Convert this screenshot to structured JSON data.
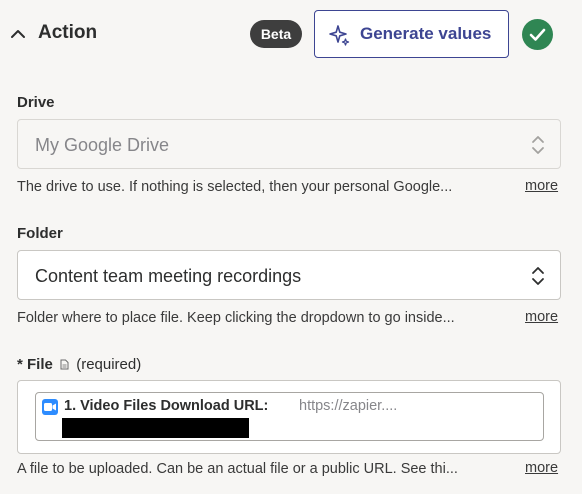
{
  "header": {
    "title": "Action",
    "badge": "Beta",
    "generate_button": "Generate values"
  },
  "drive": {
    "label": "Drive",
    "value": "My Google Drive",
    "help": "The drive to use. If nothing is selected, then your personal Google...",
    "more": "more"
  },
  "folder": {
    "label": "Folder",
    "value": "Content team meeting recordings",
    "help": "Folder where to place file. Keep clicking the dropdown to go inside...",
    "more": "more"
  },
  "file": {
    "asterisk": "*",
    "label": "File",
    "required": "(required)",
    "pill_label": "1. Video Files Download URL:",
    "pill_value": "https://zapier....",
    "help": "A file to be uploaded. Can be an actual file or a public URL. See thi...",
    "more": "more"
  },
  "colors": {
    "accent": "#3d4592",
    "success": "#2f8653",
    "badge_bg": "#3e3e3e",
    "zoom_blue": "#2d8cff"
  },
  "icons": {
    "collapse": "chevron-up-icon",
    "generate": "sparkle-icon",
    "status": "check-circle-icon",
    "select": "up-down-chevron-icon",
    "file_type": "document-icon",
    "source_app": "zoom-icon"
  }
}
